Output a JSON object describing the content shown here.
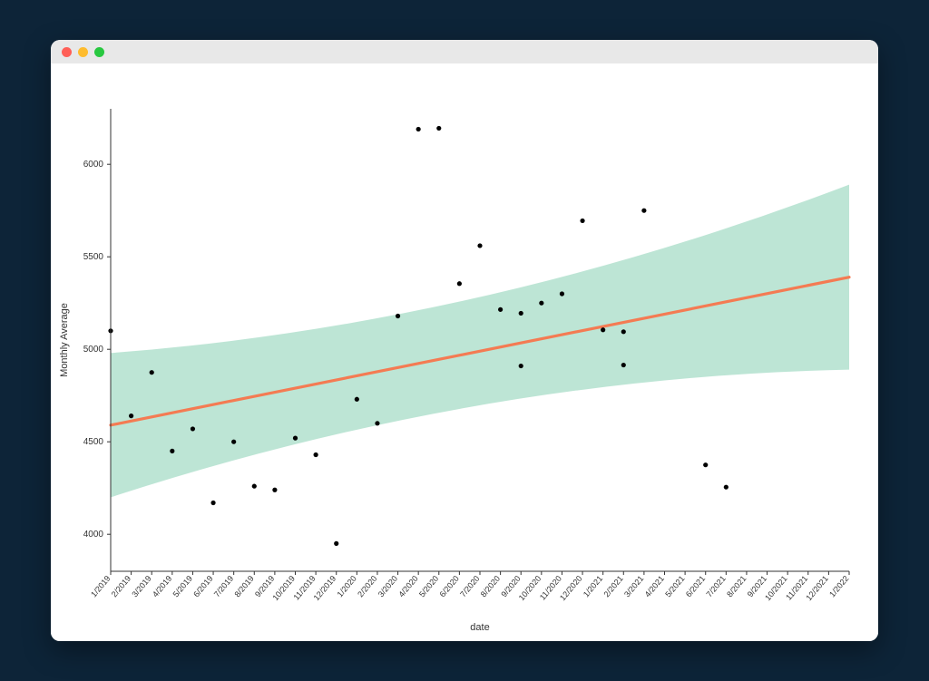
{
  "window": {
    "traffic_lights": [
      "close",
      "minimize",
      "zoom"
    ]
  },
  "chart_data": {
    "type": "scatter",
    "title": "",
    "xlabel": "date",
    "ylabel": "Monthly Average",
    "ylim": [
      3800,
      6300
    ],
    "y_ticks": [
      4000,
      4500,
      5000,
      5500,
      6000
    ],
    "x_categories": [
      "1/2019",
      "2/2019",
      "3/2019",
      "4/2019",
      "5/2019",
      "6/2019",
      "7/2019",
      "8/2019",
      "9/2019",
      "10/2019",
      "11/2019",
      "12/2019",
      "1/2020",
      "2/2020",
      "3/2020",
      "4/2020",
      "5/2020",
      "6/2020",
      "7/2020",
      "8/2020",
      "9/2020",
      "10/2020",
      "11/2020",
      "12/2020",
      "1/2021",
      "2/2021",
      "3/2021",
      "4/2021",
      "5/2021",
      "6/2021",
      "7/2021",
      "8/2021",
      "9/2021",
      "10/2021",
      "11/2021",
      "12/2021",
      "1/2022"
    ],
    "points": [
      {
        "x": "1/2019",
        "y": 5100
      },
      {
        "x": "2/2019",
        "y": 4640
      },
      {
        "x": "3/2019",
        "y": 4875
      },
      {
        "x": "4/2019",
        "y": 4450
      },
      {
        "x": "5/2019",
        "y": 4570
      },
      {
        "x": "6/2019",
        "y": 4170
      },
      {
        "x": "7/2019",
        "y": 4500
      },
      {
        "x": "8/2019",
        "y": 4260
      },
      {
        "x": "9/2019",
        "y": 4240
      },
      {
        "x": "10/2019",
        "y": 4520
      },
      {
        "x": "11/2019",
        "y": 4430
      },
      {
        "x": "12/2019",
        "y": 3950
      },
      {
        "x": "1/2020",
        "y": 4730
      },
      {
        "x": "2/2020",
        "y": 4600
      },
      {
        "x": "3/2020",
        "y": 5180
      },
      {
        "x": "4/2020",
        "y": 6190
      },
      {
        "x": "5/2020",
        "y": 6195
      },
      {
        "x": "6/2020",
        "y": 5355
      },
      {
        "x": "7/2020",
        "y": 5560
      },
      {
        "x": "8/2020",
        "y": 5215
      },
      {
        "x": "9/2020",
        "y": 5195
      },
      {
        "x": "9/2020",
        "y": 4910
      },
      {
        "x": "10/2020",
        "y": 5250
      },
      {
        "x": "11/2020",
        "y": 5300
      },
      {
        "x": "12/2020",
        "y": 5695
      },
      {
        "x": "1/2021",
        "y": 5105
      },
      {
        "x": "2/2021",
        "y": 5095
      },
      {
        "x": "2/2021",
        "y": 4915
      },
      {
        "x": "3/2021",
        "y": 5750
      },
      {
        "x": "6/2021",
        "y": 4375
      },
      {
        "x": "7/2021",
        "y": 4255
      }
    ],
    "regression": {
      "y_start": 4590,
      "y_end": 5390,
      "ci_upper_start": 4980,
      "ci_upper_end": 5890,
      "ci_lower_start": 4200,
      "ci_lower_end": 4890
    },
    "colors": {
      "line": "#f47b53",
      "ci_fill": "#b2e0ce",
      "point": "#000000"
    }
  }
}
